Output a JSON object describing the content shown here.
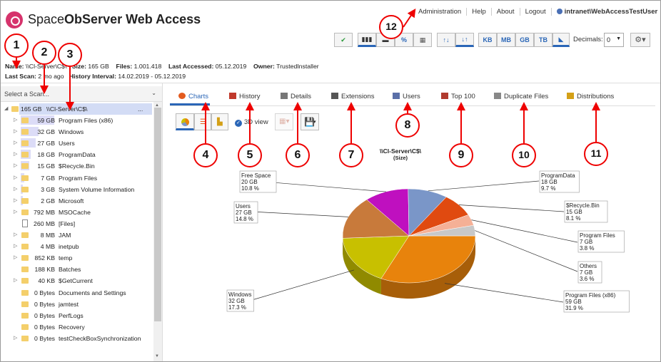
{
  "app": {
    "title_part1": "Space",
    "title_part2": "ObServer Web Access"
  },
  "toplinks": [
    "Administration",
    "Help",
    "About",
    "Logout"
  ],
  "user": "intranet\\WebAccessTestUser",
  "toolbar": {
    "units": [
      "KB",
      "MB",
      "GB",
      "TB"
    ],
    "percent": "%",
    "decimals_label": "Decimals:",
    "decimals_value": "0"
  },
  "info": {
    "name_label": "Name:",
    "name_value": "\\\\Cl-Server\\C$\\",
    "size_label": "Size:",
    "size_value": "165 GB",
    "files_label": "Files:",
    "files_value": "1.001.418",
    "accessed_label": "Last Accessed:",
    "accessed_value": "05.12.2019",
    "owner_label": "Owner:",
    "owner_value": "TrustedInstaller",
    "scan_label": "Last Scan:",
    "scan_value": "2 mo ago",
    "interval_label": "History Interval:",
    "interval_value": "14.02.2019 - 05.12.2019"
  },
  "scan_select": "Select a Scan...",
  "tree_root": {
    "size": "165 GB",
    "name": "\\\\Cl-Server\\C$\\",
    "more": "..."
  },
  "tree": [
    {
      "size": "59 GB",
      "name": "Program Files (x86)",
      "bar": 0.36,
      "type": "folder",
      "expand": true
    },
    {
      "size": "32 GB",
      "name": "Windows",
      "bar": 0.19,
      "type": "folder",
      "expand": true
    },
    {
      "size": "27 GB",
      "name": "Users",
      "bar": 0.16,
      "type": "folder",
      "expand": true
    },
    {
      "size": "18 GB",
      "name": "ProgramData",
      "bar": 0.11,
      "type": "folder",
      "expand": true
    },
    {
      "size": "15 GB",
      "name": "$Recycle.Bin",
      "bar": 0.09,
      "type": "folder",
      "expand": true
    },
    {
      "size": "7 GB",
      "name": "Program Files",
      "bar": 0.04,
      "type": "folder",
      "expand": true
    },
    {
      "size": "3 GB",
      "name": "System Volume Information",
      "bar": 0.02,
      "type": "folder",
      "expand": true
    },
    {
      "size": "2 GB",
      "name": "Microsoft",
      "bar": 0.01,
      "type": "folder",
      "expand": true
    },
    {
      "size": "792 MB",
      "name": "MSOCache",
      "bar": 0,
      "type": "folder",
      "expand": true
    },
    {
      "size": "260 MB",
      "name": "[Files]",
      "bar": 0,
      "type": "file",
      "expand": false
    },
    {
      "size": "8 MB",
      "name": "JAM",
      "bar": 0,
      "type": "folder",
      "expand": true
    },
    {
      "size": "4 MB",
      "name": "inetpub",
      "bar": 0,
      "type": "folder",
      "expand": true
    },
    {
      "size": "852 KB",
      "name": "temp",
      "bar": 0,
      "type": "folder",
      "expand": true
    },
    {
      "size": "188 KB",
      "name": "Batches",
      "bar": 0,
      "type": "folder",
      "expand": false
    },
    {
      "size": "40 KB",
      "name": "$GetCurrent",
      "bar": 0,
      "type": "folder",
      "expand": true
    },
    {
      "size": "0 Bytes",
      "name": "Documents and Settings",
      "bar": 0,
      "type": "folder",
      "expand": false
    },
    {
      "size": "0 Bytes",
      "name": "jamtest",
      "bar": 0,
      "type": "folder",
      "expand": false
    },
    {
      "size": "0 Bytes",
      "name": "PerfLogs",
      "bar": 0,
      "type": "folder",
      "expand": false
    },
    {
      "size": "0 Bytes",
      "name": "Recovery",
      "bar": 0,
      "type": "folder",
      "expand": false
    },
    {
      "size": "0 Bytes",
      "name": "testCheckBoxSynchronization",
      "bar": 0,
      "type": "folder",
      "expand": true
    }
  ],
  "tabs": [
    {
      "label": "Charts",
      "icon": "pie-icon",
      "color": "#e35b1f"
    },
    {
      "label": "History",
      "icon": "bar-history-icon",
      "color": "#c0392b"
    },
    {
      "label": "Details",
      "icon": "details-icon",
      "color": "#777777"
    },
    {
      "label": "Extensions",
      "icon": "extensions-icon",
      "color": "#555555"
    },
    {
      "label": "Users",
      "icon": "users-icon",
      "color": "#5a6fa8"
    },
    {
      "label": "Top 100",
      "icon": "top100-icon",
      "color": "#b03a2e"
    },
    {
      "label": "Duplicate Files",
      "icon": "duplicate-icon",
      "color": "#888888"
    },
    {
      "label": "Distributions",
      "icon": "distributions-icon",
      "color": "#d4a017"
    }
  ],
  "chart_toolbar": {
    "view3d": "3D view"
  },
  "chart_data": {
    "type": "pie",
    "title": "\\\\Cl-Server\\C$\\",
    "subtitle": "(Size)",
    "slices": [
      {
        "name": "Program Files (x86)",
        "size": "59 GB",
        "pct": 31.9,
        "pct_label": "31.9 %",
        "color": "#e8830c"
      },
      {
        "name": "Windows",
        "size": "32 GB",
        "pct": 17.3,
        "pct_label": "17.3 %",
        "color": "#c8c000"
      },
      {
        "name": "Users",
        "size": "27 GB",
        "pct": 14.8,
        "pct_label": "14.8 %",
        "color": "#c87a3b"
      },
      {
        "name": "Free Space",
        "size": "20 GB",
        "pct": 10.8,
        "pct_label": "10.8 %",
        "color": "#bf10bf"
      },
      {
        "name": "ProgramData",
        "size": "18 GB",
        "pct": 9.7,
        "pct_label": "9.7 %",
        "color": "#7a96c8"
      },
      {
        "name": "$Recycle.Bin",
        "size": "15 GB",
        "pct": 8.1,
        "pct_label": "8.1 %",
        "color": "#e04a10"
      },
      {
        "name": "Program Files",
        "size": "7 GB",
        "pct": 3.8,
        "pct_label": "3.8 %",
        "color": "#f5b096"
      },
      {
        "name": "Others",
        "size": "7 GB",
        "pct": 3.6,
        "pct_label": "3.6 %",
        "color": "#c8c8c8"
      }
    ]
  },
  "annotations": [
    "1",
    "2",
    "3",
    "4",
    "5",
    "6",
    "7",
    "8",
    "9",
    "10",
    "11",
    "12"
  ]
}
